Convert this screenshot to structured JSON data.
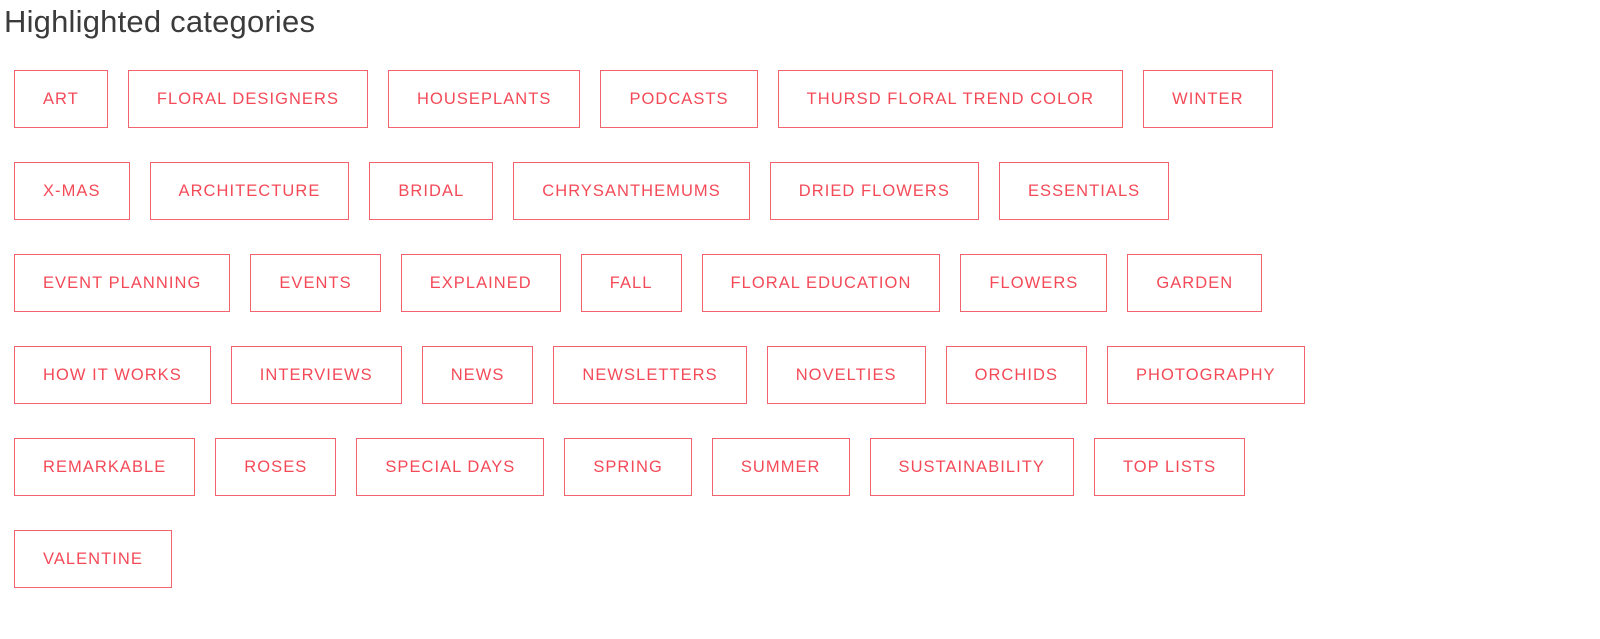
{
  "header": {
    "title": "Highlighted categories"
  },
  "theme": {
    "tag_border_color": "#f2636d",
    "tag_text_color": "#f44a58",
    "title_color": "#3b3b3b",
    "background_color": "#ffffff"
  },
  "categories": {
    "rows": [
      {
        "items": [
          {
            "label": "ART"
          },
          {
            "label": "FLORAL DESIGNERS"
          },
          {
            "label": "HOUSEPLANTS"
          },
          {
            "label": "PODCASTS"
          },
          {
            "label": "THURSD FLORAL TREND COLOR"
          },
          {
            "label": "WINTER"
          }
        ]
      },
      {
        "items": [
          {
            "label": "X-MAS"
          },
          {
            "label": "ARCHITECTURE"
          },
          {
            "label": "BRIDAL"
          },
          {
            "label": "CHRYSANTHEMUMS"
          },
          {
            "label": "DRIED FLOWERS"
          },
          {
            "label": "ESSENTIALS"
          }
        ]
      },
      {
        "items": [
          {
            "label": "EVENT PLANNING"
          },
          {
            "label": "EVENTS"
          },
          {
            "label": "EXPLAINED"
          },
          {
            "label": "FALL"
          },
          {
            "label": "FLORAL EDUCATION"
          },
          {
            "label": "FLOWERS"
          },
          {
            "label": "GARDEN"
          }
        ]
      },
      {
        "items": [
          {
            "label": "HOW IT WORKS"
          },
          {
            "label": "INTERVIEWS"
          },
          {
            "label": "NEWS"
          },
          {
            "label": "NEWSLETTERS"
          },
          {
            "label": "NOVELTIES"
          },
          {
            "label": "ORCHIDS"
          },
          {
            "label": "PHOTOGRAPHY"
          }
        ]
      },
      {
        "items": [
          {
            "label": "REMARKABLE"
          },
          {
            "label": "ROSES"
          },
          {
            "label": "SPECIAL DAYS"
          },
          {
            "label": "SPRING"
          },
          {
            "label": "SUMMER"
          },
          {
            "label": "SUSTAINABILITY"
          },
          {
            "label": "TOP LISTS"
          }
        ]
      },
      {
        "items": [
          {
            "label": "VALENTINE"
          }
        ]
      }
    ]
  }
}
